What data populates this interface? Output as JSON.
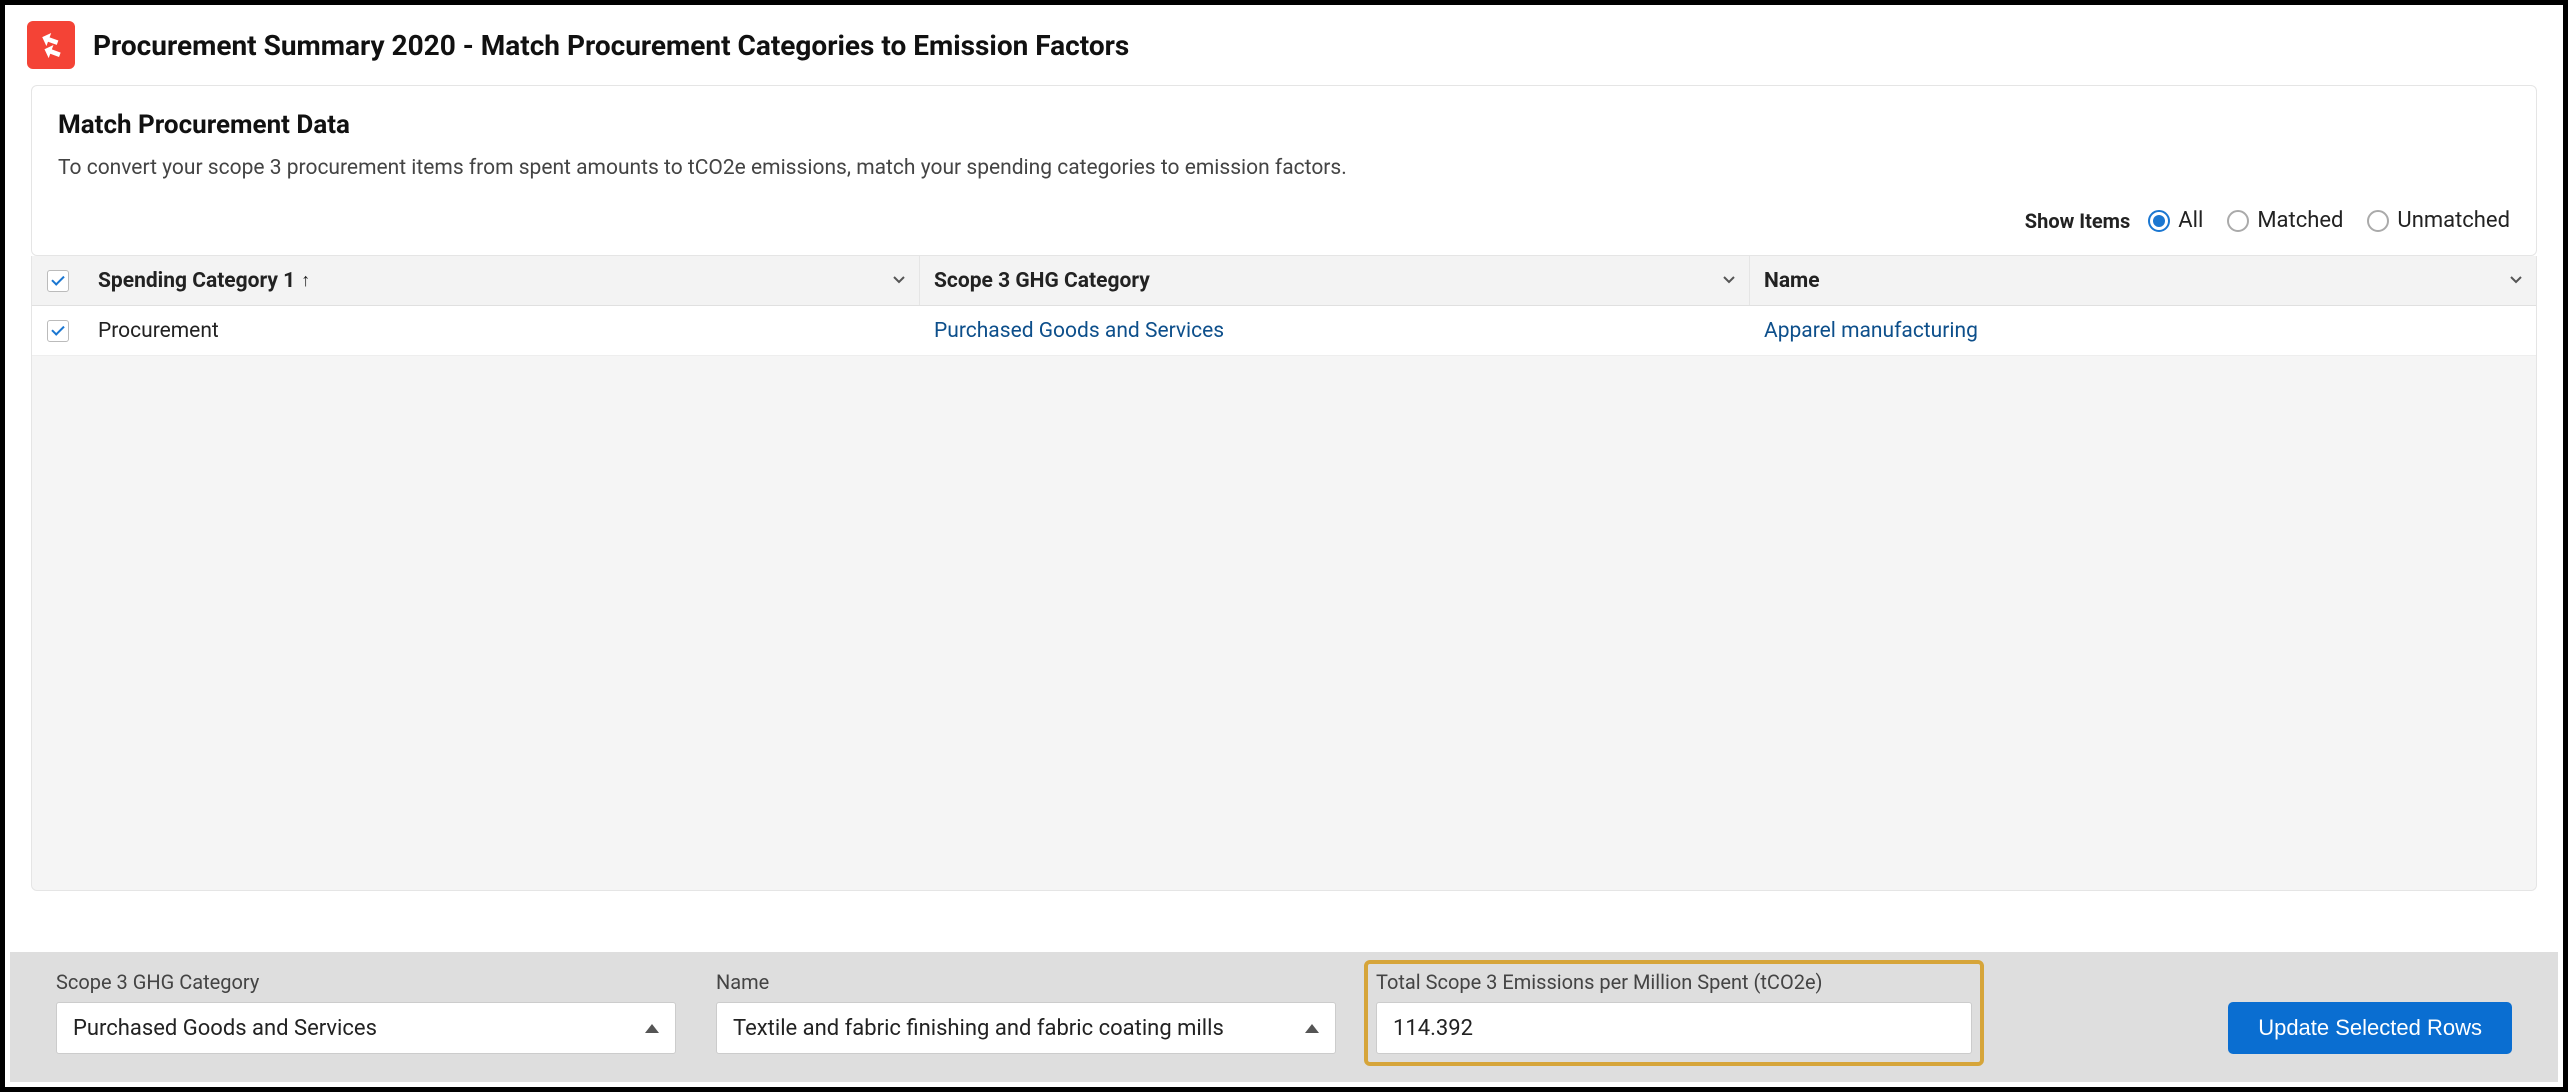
{
  "header": {
    "title": "Procurement Summary 2020 - Match Procurement Categories to Emission Factors"
  },
  "panel": {
    "title": "Match Procurement Data",
    "description": "To convert your scope 3 procurement items from spent amounts to tCO2e emissions, match your spending categories to emission factors.",
    "filter": {
      "label": "Show Items",
      "options": {
        "all": "All",
        "matched": "Matched",
        "unmatched": "Unmatched"
      },
      "selected": "all"
    }
  },
  "table": {
    "columns": {
      "spending_category": "Spending Category 1",
      "ghg_category": "Scope 3 GHG Category",
      "name": "Name"
    },
    "rows": [
      {
        "spending_category": "Procurement",
        "ghg_category": "Purchased Goods and Services",
        "name": "Apparel manufacturing"
      }
    ]
  },
  "footer": {
    "ghg_category": {
      "label": "Scope 3 GHG Category",
      "value": "Purchased Goods and Services"
    },
    "name": {
      "label": "Name",
      "value": "Textile and fabric finishing and fabric coating mills"
    },
    "emissions": {
      "label": "Total Scope 3 Emissions per Million Spent (tCO2e)",
      "value": "114.392"
    },
    "update_button": "Update Selected Rows"
  }
}
